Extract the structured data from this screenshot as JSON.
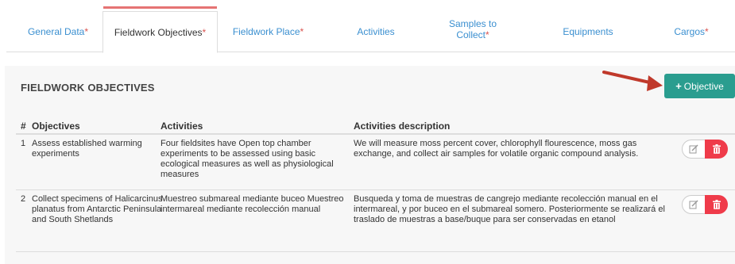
{
  "tabs": [
    {
      "label": "General Data",
      "required": "*"
    },
    {
      "label": "Fieldwork Objectives",
      "required": "*"
    },
    {
      "label": "Fieldwork Place",
      "required": "*"
    },
    {
      "label": "Activities",
      "required": ""
    },
    {
      "label_line1": "Samples to",
      "label_line2": "Collect",
      "required": "*"
    },
    {
      "label": "Equipments",
      "required": ""
    },
    {
      "label": "Cargos",
      "required": "*"
    }
  ],
  "section": {
    "title": "FIELDWORK OBJECTIVES",
    "add_button_label": "Objective",
    "add_button_color": "#2a9d8f",
    "arrow_color": "#c0392b"
  },
  "table": {
    "headers": {
      "num": "#",
      "objectives": "Objectives",
      "activities": "Activities",
      "description": "Activities description"
    },
    "rows": [
      {
        "num": "1",
        "objective": "Assess established warming experiments",
        "activities": "Four fieldsites have Open top chamber experiments to be assessed using basic ecological measures as well as physiological measures",
        "description": "We will measure moss percent cover, chlorophyll flourescence, moss gas exchange, and collect air samples for volatile organic compound analysis."
      },
      {
        "num": "2",
        "objective": "Collect specimens of Halicarcinus planatus from Antarctic Peninsula and South Shetlands",
        "activities": "Muestreo submareal mediante buceo Muestreo intermareal mediante recolección manual",
        "description": "Busqueda y toma de muestras de cangrejo mediante recolección manual en el intermareal, y por buceo en el submareal somero. Posteriormente se realizará el traslado de muestras a base/buque para ser conservadas en etanol"
      }
    ]
  },
  "colors": {
    "tab_link": "#3a8fd0",
    "required_mark": "#d9534f",
    "delete_button": "#ef3b4a",
    "active_tab_bar": "#e57373"
  }
}
